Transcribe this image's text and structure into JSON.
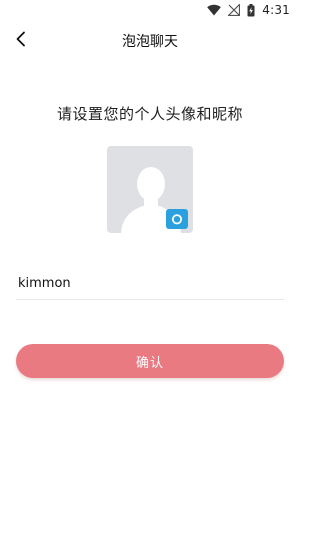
{
  "status_bar": {
    "time": "4:31",
    "icons": [
      "wifi-icon",
      "no-signal-icon",
      "battery-charging-icon"
    ]
  },
  "header": {
    "title": "泡泡聊天",
    "back_icon": "chevron-left-icon"
  },
  "prompt": "请设置您的个人头像和昵称",
  "avatar": {
    "placeholder_icon": "person-silhouette-icon",
    "badge_icon": "camera-icon",
    "background": "#dfe0e3",
    "badge_color": "#2aa1de"
  },
  "nickname": {
    "value": "kimmon",
    "placeholder": ""
  },
  "confirm_button": {
    "label": "确认",
    "color": "#e97a82"
  }
}
